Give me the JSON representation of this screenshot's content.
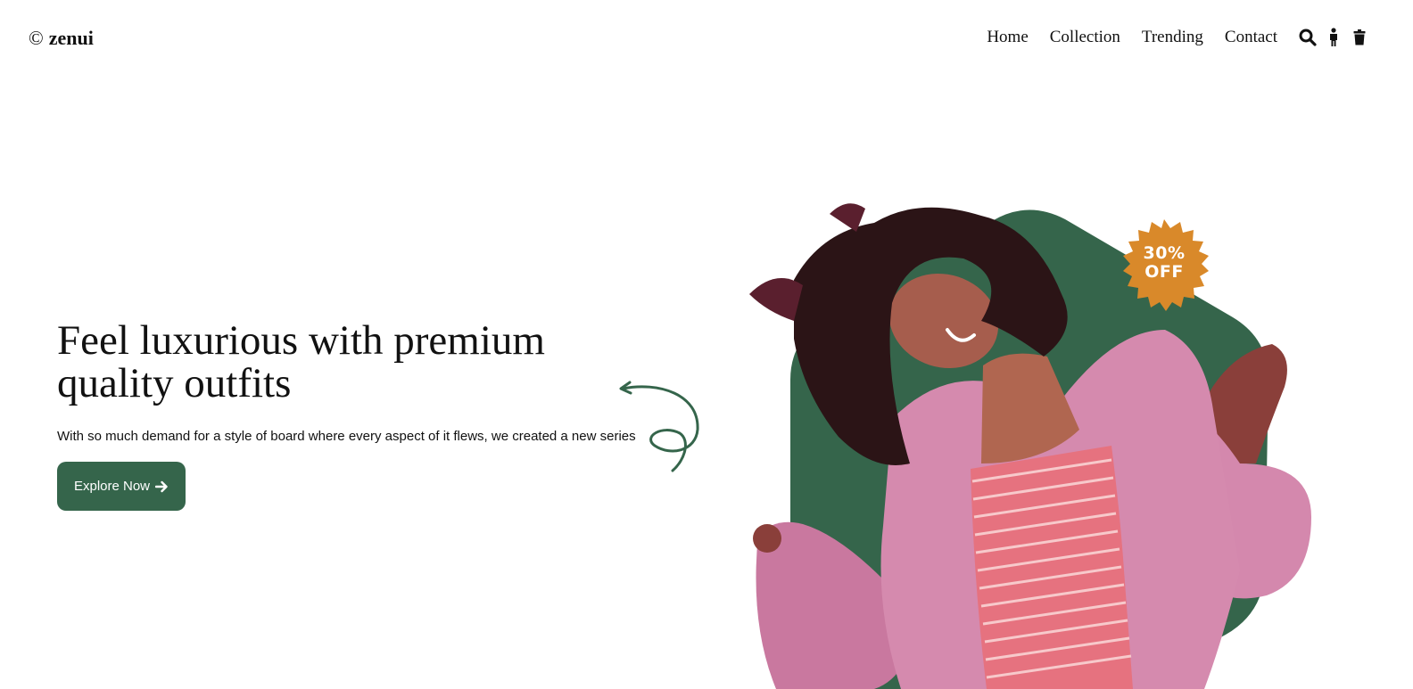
{
  "brand": {
    "mark": "©",
    "name": "zenui"
  },
  "nav": {
    "items": [
      "Home",
      "Collection",
      "Trending",
      "Contact"
    ]
  },
  "header_icons": [
    "search-icon",
    "person-icon",
    "trash-icon"
  ],
  "hero": {
    "title": "Feel luxurious with premium quality outfits",
    "subtitle": "With so much demand for a style of board where every aspect of it flews, we created a new series",
    "cta_label": "Explore Now",
    "cta_icon": "arrow-right-icon"
  },
  "badge": {
    "line1": "30%",
    "line2": "OFF"
  },
  "colors": {
    "accent": "#35654b",
    "badge": "#d9892a",
    "text": "#111111"
  }
}
